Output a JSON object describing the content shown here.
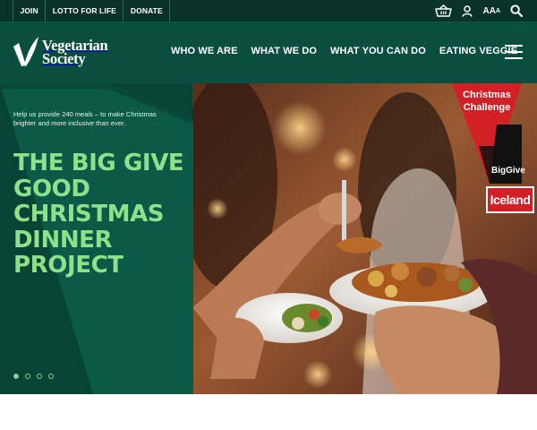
{
  "topbar": {
    "links": [
      "JOIN",
      "LOTTO FOR LIFE",
      "DONATE"
    ],
    "text_size_label": "AAA"
  },
  "logo": {
    "line1": "Vegetarian",
    "line2": "Society"
  },
  "nav": {
    "items": [
      "WHO WE ARE",
      "WHAT WE DO",
      "WHAT YOU CAN DO",
      "EATING VEGGIE"
    ]
  },
  "hero": {
    "blurb": "Help us provide 240 meals – to make Christmas brighter and more inclusive than ever.",
    "headline": "THE BIG GIVE GOOD CHRISTMAS DINNER PROJECT",
    "slide_count": 4,
    "active_slide": 1,
    "badge": {
      "title_line1": "Christmas",
      "title_line2": "Challenge",
      "brand": "BigGive",
      "sponsor": "Iceland"
    }
  },
  "colors": {
    "topbar_bg": "#08322a",
    "header_bg": "#0a4e3f",
    "hero_bg": "#074436",
    "headline": "#8ee08a",
    "badge_red": "#d32026"
  },
  "icons": [
    "basket-icon",
    "account-icon",
    "text-size-icon",
    "search-icon",
    "hamburger-icon",
    "vegetarian-society-v-logo"
  ]
}
